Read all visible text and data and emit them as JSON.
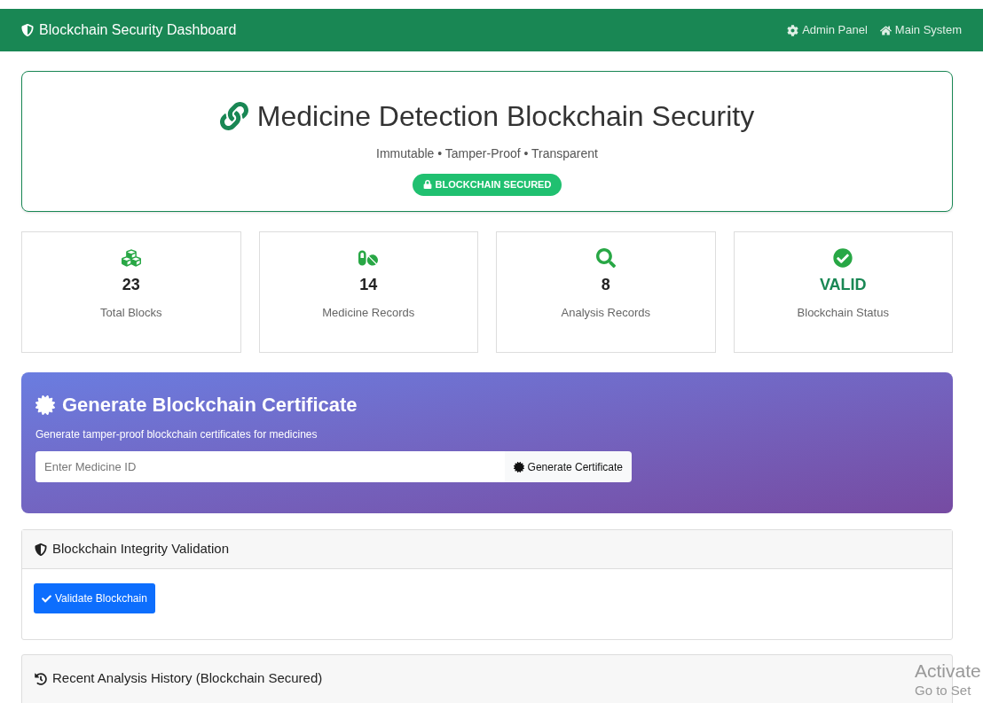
{
  "navbar": {
    "brand": "Blockchain Security Dashboard",
    "links": [
      {
        "kind": "settings",
        "label": "Admin Panel"
      },
      {
        "kind": "home",
        "label": "Main System"
      }
    ]
  },
  "hero": {
    "title": "Medicine Detection Blockchain Security",
    "subtitle": "Immutable • Tamper-Proof • Transparent",
    "badge": "BLOCKCHAIN SECURED"
  },
  "stats": [
    {
      "kind": "blocks",
      "value": "23",
      "label": "Total Blocks"
    },
    {
      "kind": "medicine",
      "value": "14",
      "label": "Medicine Records"
    },
    {
      "kind": "analysis",
      "value": "8",
      "label": "Analysis Records"
    },
    {
      "kind": "status",
      "value": "VALID",
      "label": "Blockchain Status"
    }
  ],
  "certificate": {
    "title": "Generate Blockchain Certificate",
    "description": "Generate tamper-proof blockchain certificates for medicines",
    "placeholder": "Enter Medicine ID",
    "button": "Generate Certificate"
  },
  "validation": {
    "title": "Blockchain Integrity Validation",
    "button": "Validate Blockchain"
  },
  "history": {
    "title": "Recent Analysis History (Blockchain Secured)"
  },
  "os_notice": {
    "line1": "Activate",
    "line2": "Go to Set"
  }
}
